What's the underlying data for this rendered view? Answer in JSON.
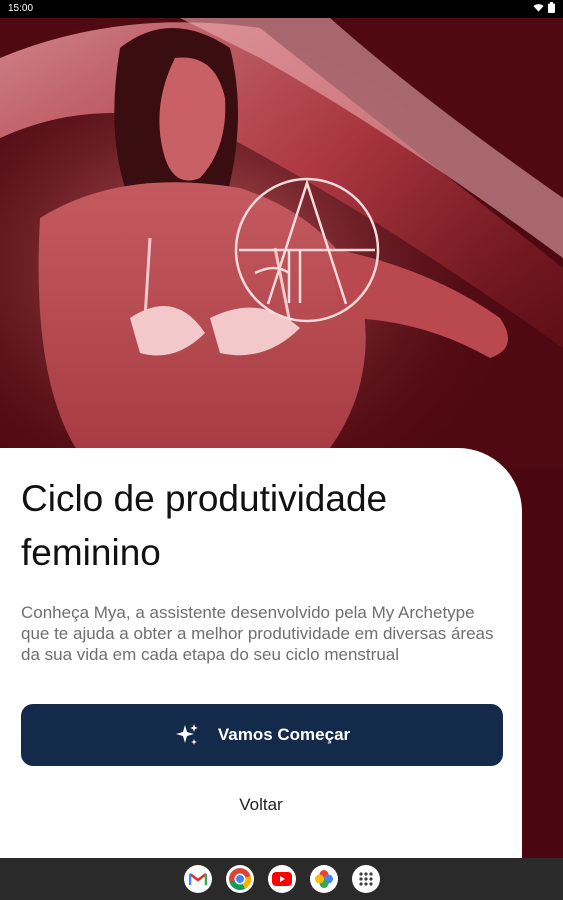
{
  "status_bar": {
    "time": "15:00"
  },
  "onboarding": {
    "title": "Ciclo de produtividade feminino",
    "description": "Conheça Mya, a assistente desenvolvido pela My Archetype que te ajuda a obter a melhor produtividade em diversas áreas da sua vida em cada etapa do seu ciclo menstrual",
    "primary_button": {
      "label": "Vamos Começar",
      "icon": "sparkles-icon"
    },
    "secondary_button": {
      "label": "Voltar"
    }
  },
  "dock": {
    "apps": [
      {
        "name": "gmail-icon"
      },
      {
        "name": "chrome-icon"
      },
      {
        "name": "youtube-icon"
      },
      {
        "name": "photos-icon"
      },
      {
        "name": "app-drawer-icon"
      }
    ]
  },
  "colors": {
    "hero_bg": "#5b0c14",
    "button_bg": "#142a4a",
    "nav_bg": "#2a2a2a"
  }
}
